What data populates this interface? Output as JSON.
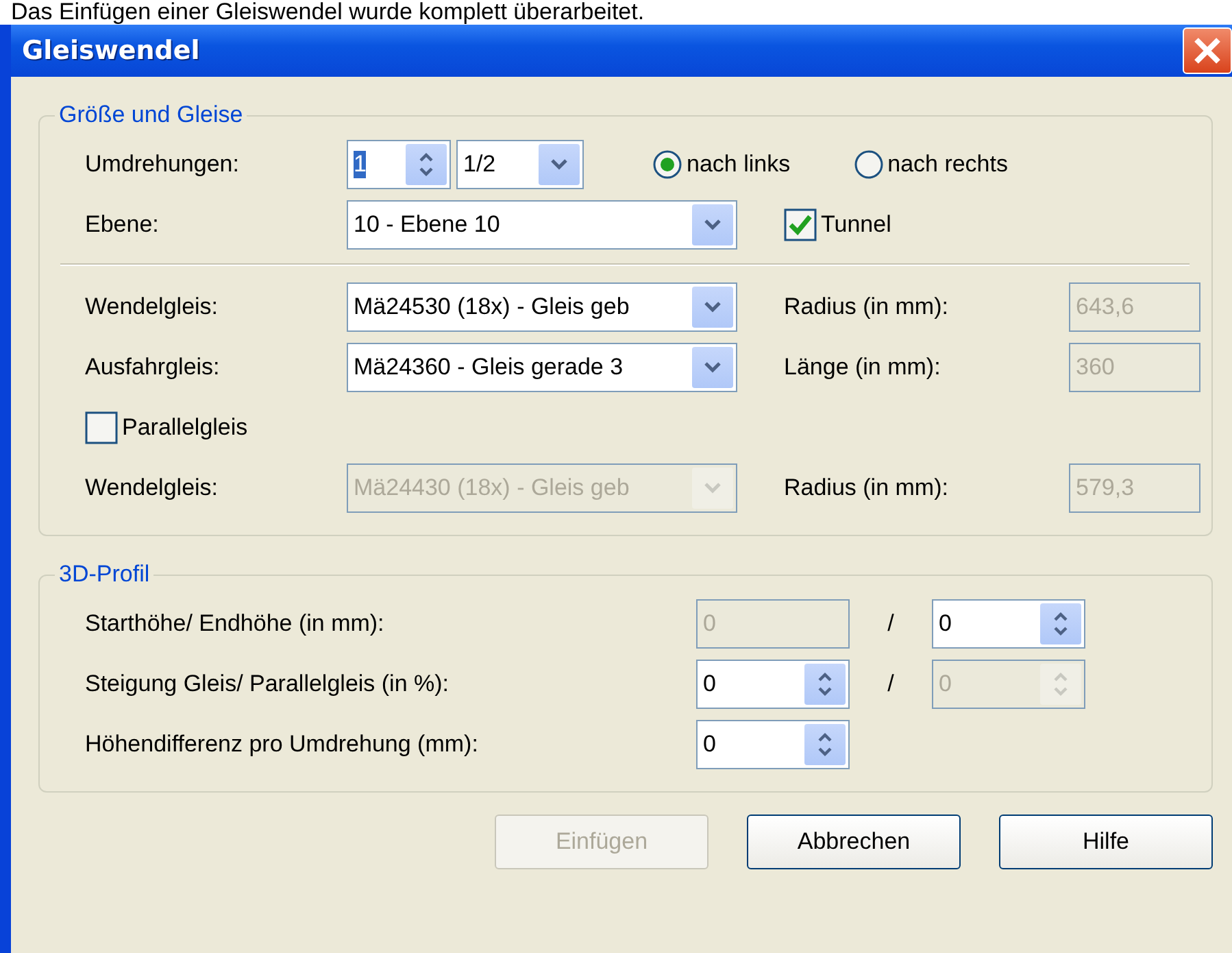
{
  "caption": "Das Einfügen einer Gleiswendel wurde komplett überarbeitet.",
  "window": {
    "title": "Gleiswendel"
  },
  "size_group": {
    "title": "Größe und Gleise",
    "turns": {
      "label": "Umdrehungen:",
      "spin": {
        "value": "1",
        "value_selected": true
      },
      "fraction": {
        "value": "1/2"
      }
    },
    "direction": [
      {
        "label": "nach links",
        "selected": true
      },
      {
        "label": "nach rechts",
        "selected": false
      }
    ],
    "level": {
      "label": "Ebene:",
      "value": "10 - Ebene 10"
    },
    "tunnel": {
      "label": "Tunnel",
      "checked": true
    },
    "track_rows": [
      {
        "label": "Wendelgleis:",
        "value": "Mä24530 (18x) - Gleis geb",
        "disabled": false,
        "info_label": "Radius (in mm):",
        "info_value": "643,6"
      },
      {
        "label": "Ausfahrgleis:",
        "value": "Mä24360 - Gleis gerade 3",
        "disabled": false,
        "info_label": "Länge (in mm):",
        "info_value": "360"
      }
    ],
    "parallel": {
      "label": "Parallelgleis",
      "checked": false
    },
    "parallel_row": {
      "label": "Wendelgleis:",
      "value": "Mä24430 (18x) - Gleis geb",
      "disabled": true,
      "info_label": "Radius (in mm):",
      "info_value": "579,3"
    }
  },
  "profile_group": {
    "title": "3D-Profil",
    "rows": [
      {
        "label": "Starthöhe/ Endhöhe (in mm):",
        "slash": "/",
        "fields": [
          {
            "kind": "text",
            "value": "0",
            "disabled": true
          },
          {
            "kind": "spin",
            "value": "0",
            "disabled": false
          }
        ]
      },
      {
        "label": "Steigung Gleis/ Parallelgleis (in %):",
        "slash": "/",
        "fields": [
          {
            "kind": "spin",
            "value": "0",
            "disabled": false
          },
          {
            "kind": "spin",
            "value": "0",
            "disabled": true
          }
        ]
      },
      {
        "label": "Höhendifferenz pro Umdrehung (mm):",
        "fields": [
          {
            "kind": "spin",
            "value": "0",
            "disabled": false
          }
        ]
      }
    ]
  },
  "buttons": [
    {
      "label": "Einfügen",
      "disabled": true
    },
    {
      "label": "Abbrechen",
      "disabled": false
    },
    {
      "label": "Hilfe",
      "disabled": false
    }
  ]
}
